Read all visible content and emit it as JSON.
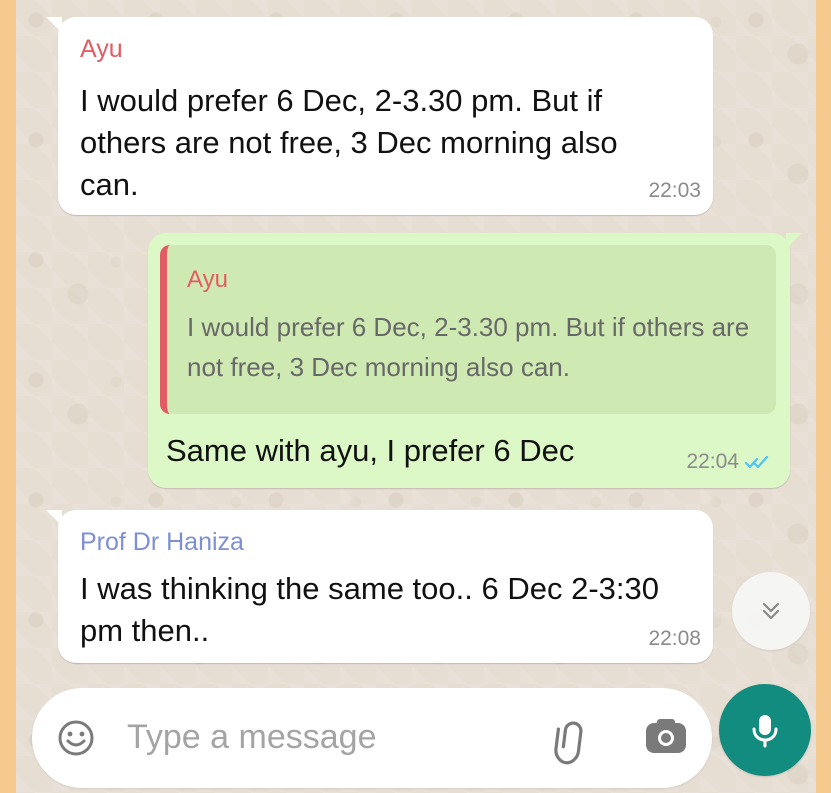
{
  "messages": [
    {
      "sender": "Ayu",
      "text": "I would prefer 6 Dec, 2-3.30 pm. But if others are not free, 3 Dec morning also can.",
      "time": "22:03"
    },
    {
      "quoted": {
        "sender": "Ayu",
        "text": "I would prefer 6 Dec, 2-3.30 pm. But if others are not free, 3 Dec morning also can."
      },
      "text": "Same with ayu, I prefer 6 Dec",
      "time": "22:04",
      "status": "read"
    },
    {
      "sender": "Prof Dr Haniza",
      "text": "I was thinking the same too.. 6 Dec 2-3:30 pm then..",
      "time": "22:08"
    }
  ],
  "composer": {
    "placeholder": "Type a message",
    "value": ""
  },
  "icons": {
    "emoji": "emoji-icon",
    "attach": "paperclip-icon",
    "camera": "camera-icon",
    "mic": "microphone-icon",
    "scroll": "chevron-down-double-icon",
    "read": "double-check-icon"
  },
  "colors": {
    "background_frame": "#F6C98E",
    "chat_background": "#E7DED3",
    "incoming_bubble": "#FFFFFF",
    "outgoing_bubble": "#DCF8C6",
    "quote_background": "#CFE9B2",
    "ayu_name": "#E45C63",
    "prof_name": "#7E8FD3",
    "accent_green": "#128C7E",
    "read_ticks": "#4FC3F7"
  }
}
